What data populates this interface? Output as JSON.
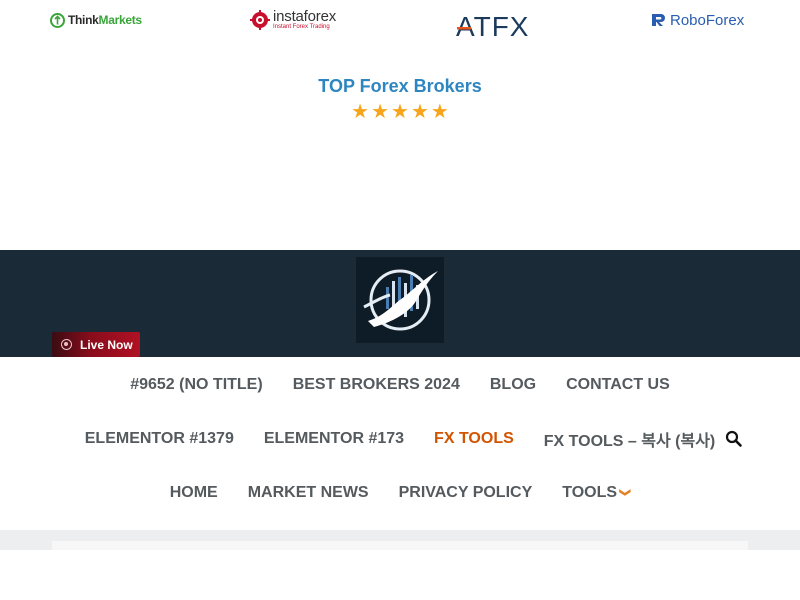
{
  "brokers": {
    "thinkmarkets": {
      "part1": "Think",
      "part2": "Markets"
    },
    "instaforex": {
      "name": "instaforex",
      "tagline": "Instant Forex Trading"
    },
    "atfx": {
      "name": "ATFX"
    },
    "roboforex": {
      "name": "RoboForex"
    }
  },
  "top_section": {
    "title": "TOP Forex Brokers",
    "rating_stars": 5,
    "star_color": "#f7a51c"
  },
  "header": {
    "background": "#1a2a36",
    "live_now": "Live Now"
  },
  "nav": {
    "row1": [
      "#9652 (NO TITLE)",
      "BEST BROKERS 2024",
      "BLOG",
      "CONTACT US"
    ],
    "row2": [
      "ELEMENTOR #1379",
      "ELEMENTOR #173",
      "FX TOOLS",
      "FX TOOLS – 복사 (복사)"
    ],
    "row3": [
      "HOME",
      "MARKET NEWS",
      "PRIVACY POLICY",
      "TOOLS"
    ],
    "active_item": "FX TOOLS",
    "text_color": "#555a5e",
    "active_color": "#d35400"
  },
  "icons": {
    "search": "search-icon",
    "dropdown": "chevron-down-icon"
  }
}
